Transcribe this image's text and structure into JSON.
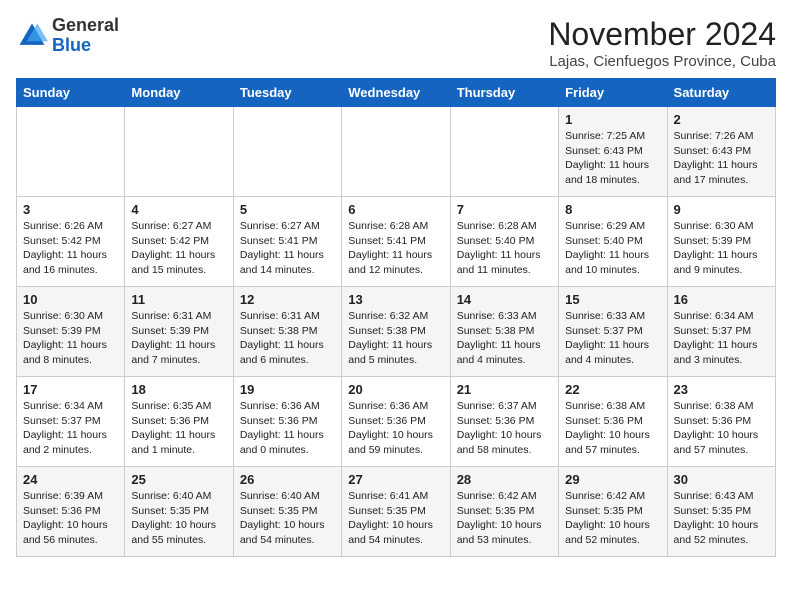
{
  "logo": {
    "general": "General",
    "blue": "Blue"
  },
  "header": {
    "month": "November 2024",
    "location": "Lajas, Cienfuegos Province, Cuba"
  },
  "days_of_week": [
    "Sunday",
    "Monday",
    "Tuesday",
    "Wednesday",
    "Thursday",
    "Friday",
    "Saturday"
  ],
  "weeks": [
    [
      {
        "day": "",
        "info": ""
      },
      {
        "day": "",
        "info": ""
      },
      {
        "day": "",
        "info": ""
      },
      {
        "day": "",
        "info": ""
      },
      {
        "day": "",
        "info": ""
      },
      {
        "day": "1",
        "info": "Sunrise: 7:25 AM\nSunset: 6:43 PM\nDaylight: 11 hours and 18 minutes."
      },
      {
        "day": "2",
        "info": "Sunrise: 7:26 AM\nSunset: 6:43 PM\nDaylight: 11 hours and 17 minutes."
      }
    ],
    [
      {
        "day": "3",
        "info": "Sunrise: 6:26 AM\nSunset: 5:42 PM\nDaylight: 11 hours and 16 minutes."
      },
      {
        "day": "4",
        "info": "Sunrise: 6:27 AM\nSunset: 5:42 PM\nDaylight: 11 hours and 15 minutes."
      },
      {
        "day": "5",
        "info": "Sunrise: 6:27 AM\nSunset: 5:41 PM\nDaylight: 11 hours and 14 minutes."
      },
      {
        "day": "6",
        "info": "Sunrise: 6:28 AM\nSunset: 5:41 PM\nDaylight: 11 hours and 12 minutes."
      },
      {
        "day": "7",
        "info": "Sunrise: 6:28 AM\nSunset: 5:40 PM\nDaylight: 11 hours and 11 minutes."
      },
      {
        "day": "8",
        "info": "Sunrise: 6:29 AM\nSunset: 5:40 PM\nDaylight: 11 hours and 10 minutes."
      },
      {
        "day": "9",
        "info": "Sunrise: 6:30 AM\nSunset: 5:39 PM\nDaylight: 11 hours and 9 minutes."
      }
    ],
    [
      {
        "day": "10",
        "info": "Sunrise: 6:30 AM\nSunset: 5:39 PM\nDaylight: 11 hours and 8 minutes."
      },
      {
        "day": "11",
        "info": "Sunrise: 6:31 AM\nSunset: 5:39 PM\nDaylight: 11 hours and 7 minutes."
      },
      {
        "day": "12",
        "info": "Sunrise: 6:31 AM\nSunset: 5:38 PM\nDaylight: 11 hours and 6 minutes."
      },
      {
        "day": "13",
        "info": "Sunrise: 6:32 AM\nSunset: 5:38 PM\nDaylight: 11 hours and 5 minutes."
      },
      {
        "day": "14",
        "info": "Sunrise: 6:33 AM\nSunset: 5:38 PM\nDaylight: 11 hours and 4 minutes."
      },
      {
        "day": "15",
        "info": "Sunrise: 6:33 AM\nSunset: 5:37 PM\nDaylight: 11 hours and 4 minutes."
      },
      {
        "day": "16",
        "info": "Sunrise: 6:34 AM\nSunset: 5:37 PM\nDaylight: 11 hours and 3 minutes."
      }
    ],
    [
      {
        "day": "17",
        "info": "Sunrise: 6:34 AM\nSunset: 5:37 PM\nDaylight: 11 hours and 2 minutes."
      },
      {
        "day": "18",
        "info": "Sunrise: 6:35 AM\nSunset: 5:36 PM\nDaylight: 11 hours and 1 minute."
      },
      {
        "day": "19",
        "info": "Sunrise: 6:36 AM\nSunset: 5:36 PM\nDaylight: 11 hours and 0 minutes."
      },
      {
        "day": "20",
        "info": "Sunrise: 6:36 AM\nSunset: 5:36 PM\nDaylight: 10 hours and 59 minutes."
      },
      {
        "day": "21",
        "info": "Sunrise: 6:37 AM\nSunset: 5:36 PM\nDaylight: 10 hours and 58 minutes."
      },
      {
        "day": "22",
        "info": "Sunrise: 6:38 AM\nSunset: 5:36 PM\nDaylight: 10 hours and 57 minutes."
      },
      {
        "day": "23",
        "info": "Sunrise: 6:38 AM\nSunset: 5:36 PM\nDaylight: 10 hours and 57 minutes."
      }
    ],
    [
      {
        "day": "24",
        "info": "Sunrise: 6:39 AM\nSunset: 5:36 PM\nDaylight: 10 hours and 56 minutes."
      },
      {
        "day": "25",
        "info": "Sunrise: 6:40 AM\nSunset: 5:35 PM\nDaylight: 10 hours and 55 minutes."
      },
      {
        "day": "26",
        "info": "Sunrise: 6:40 AM\nSunset: 5:35 PM\nDaylight: 10 hours and 54 minutes."
      },
      {
        "day": "27",
        "info": "Sunrise: 6:41 AM\nSunset: 5:35 PM\nDaylight: 10 hours and 54 minutes."
      },
      {
        "day": "28",
        "info": "Sunrise: 6:42 AM\nSunset: 5:35 PM\nDaylight: 10 hours and 53 minutes."
      },
      {
        "day": "29",
        "info": "Sunrise: 6:42 AM\nSunset: 5:35 PM\nDaylight: 10 hours and 52 minutes."
      },
      {
        "day": "30",
        "info": "Sunrise: 6:43 AM\nSunset: 5:35 PM\nDaylight: 10 hours and 52 minutes."
      }
    ]
  ]
}
